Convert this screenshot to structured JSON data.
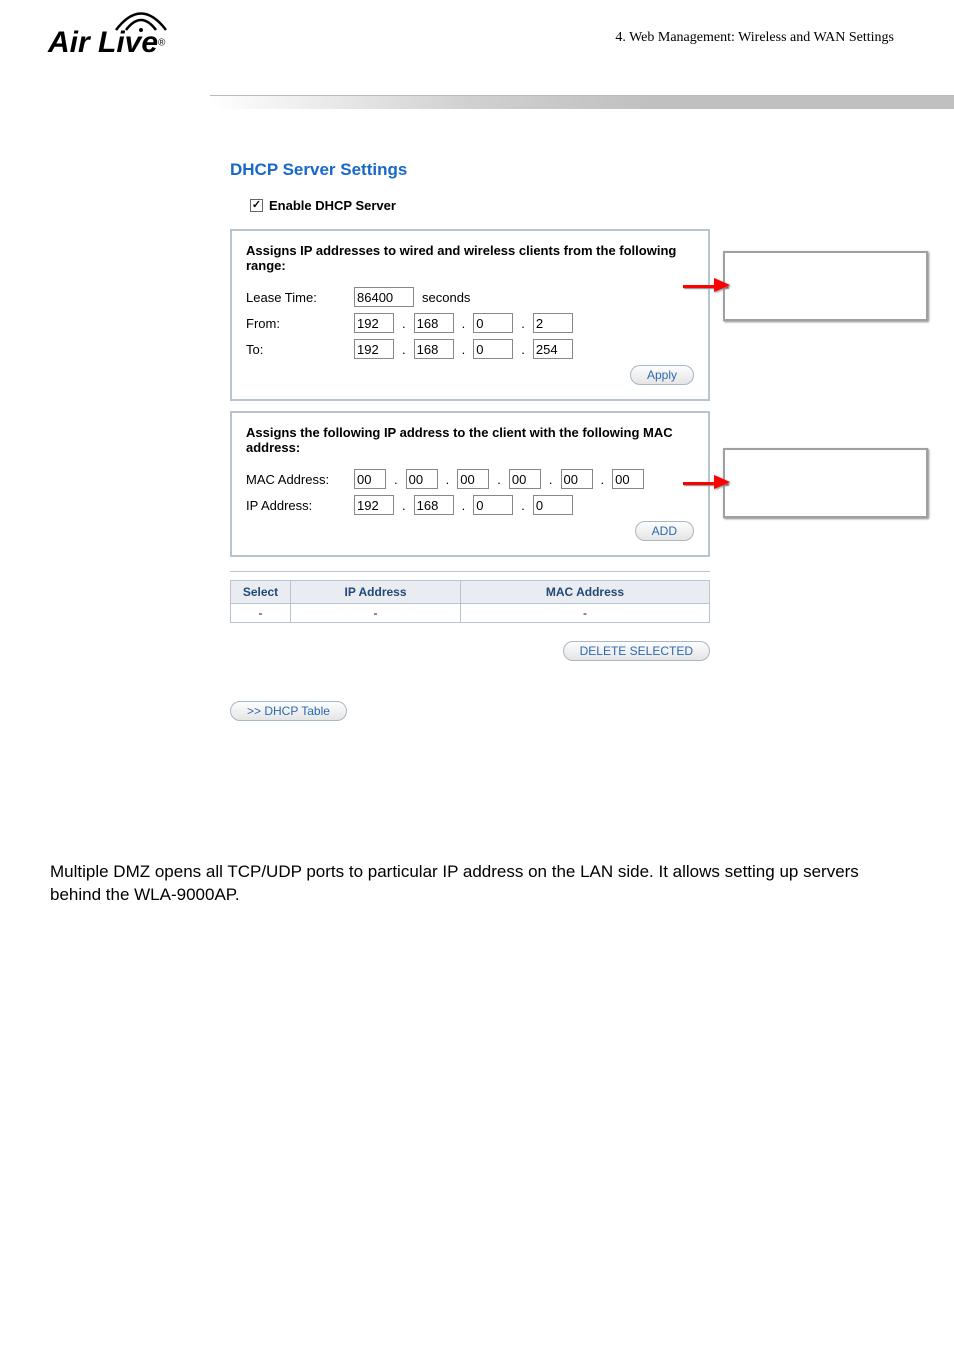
{
  "header": {
    "chapter": "4. Web Management: Wireless and WAN Settings",
    "brand": "Air Live"
  },
  "dhcp": {
    "title": "DHCP Server Settings",
    "enable_label": "Enable DHCP Server",
    "enable_checked": true,
    "range_panel": {
      "title": "Assigns IP addresses to wired and wireless clients from the following range:",
      "lease_label": "Lease Time:",
      "lease_value": "86400",
      "lease_unit": "seconds",
      "from_label": "From:",
      "from": [
        "192",
        "168",
        "0",
        "2"
      ],
      "to_label": "To:",
      "to": [
        "192",
        "168",
        "0",
        "254"
      ],
      "apply_label": "Apply"
    },
    "static_panel": {
      "title": "Assigns the following IP address to the client with the following MAC address:",
      "mac_label": "MAC Address:",
      "mac": [
        "00",
        "00",
        "00",
        "00",
        "00",
        "00"
      ],
      "ip_label": "IP Address:",
      "ip": [
        "192",
        "168",
        "0",
        "0"
      ],
      "add_label": "ADD"
    },
    "table": {
      "col_select": "Select",
      "col_ip": "IP Address",
      "col_mac": "MAC Address",
      "row": {
        "select": "-",
        "ip": "-",
        "mac": "-"
      },
      "delete_label": "DELETE SELECTED"
    },
    "dhcp_table_btn": ">> DHCP Table"
  },
  "body_paragraph": "Multiple DMZ opens all TCP/UDP ports to particular IP address on the LAN side.   It allows setting up servers behind the WLA-9000AP."
}
